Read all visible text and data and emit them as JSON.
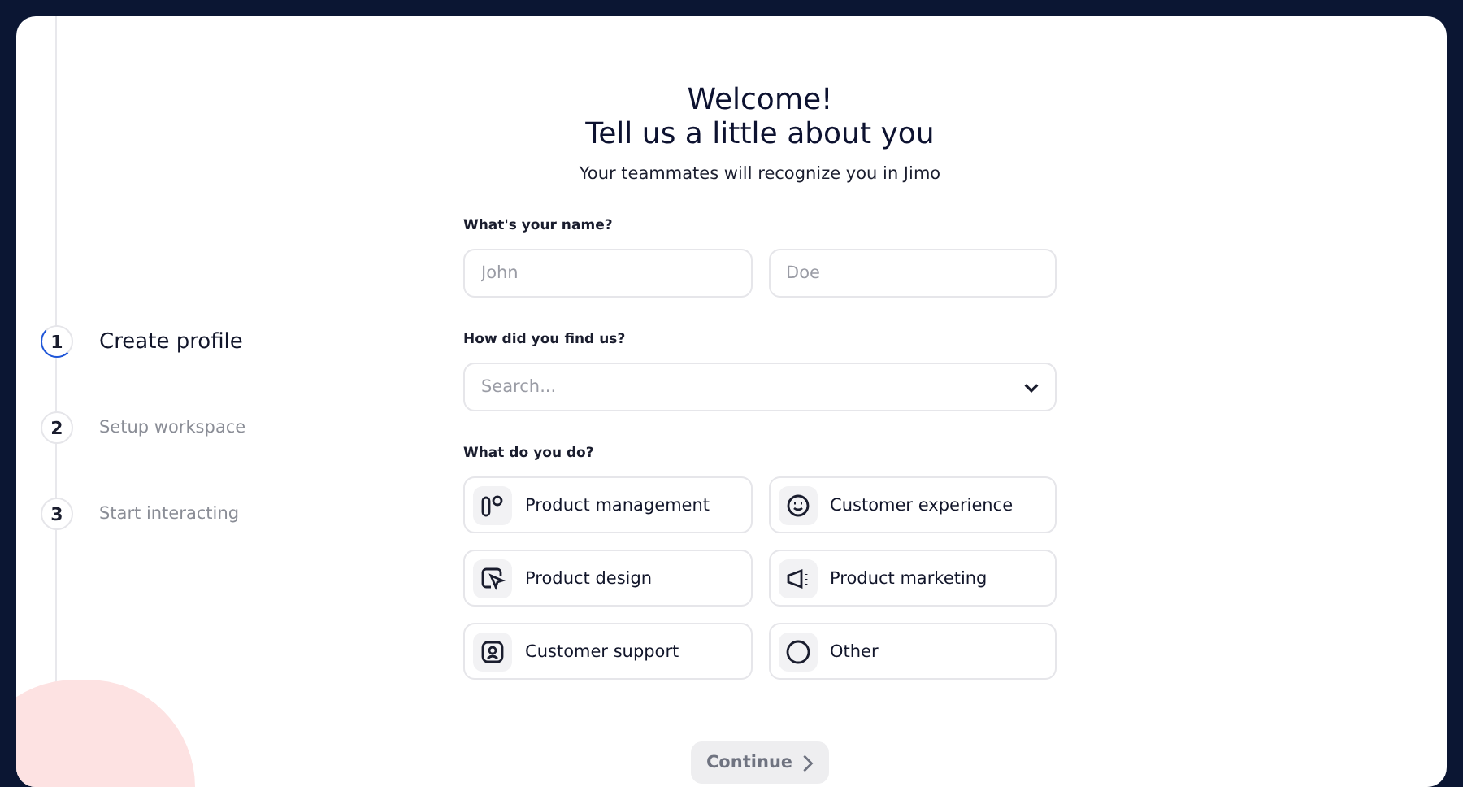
{
  "steps": [
    {
      "number": "1",
      "label": "Create profile",
      "selected": true
    },
    {
      "number": "2",
      "label": "Setup workspace",
      "selected": false
    },
    {
      "number": "3",
      "label": "Start interacting",
      "selected": false
    }
  ],
  "heading": {
    "line_1": "Welcome!",
    "line_2": "Tell us a little about you"
  },
  "subtitle": "Your teammates will recognize you in Jimo",
  "name_question": {
    "label": "What's your name?",
    "first_name": {
      "placeholder": "John"
    },
    "last_name": {
      "placeholder": "Doe"
    }
  },
  "source_question": {
    "label": "How did you find us?",
    "placeholder": "Search..."
  },
  "role_question": {
    "label": "What do you do?",
    "options": [
      {
        "kind": "management",
        "label": "Product management",
        "selected": false
      },
      {
        "kind": "experience",
        "label": "Customer experience",
        "selected": false
      },
      {
        "kind": "design",
        "label": "Product design",
        "selected": false
      },
      {
        "kind": "marketing",
        "label": "Product marketing",
        "selected": false
      },
      {
        "kind": "support",
        "label": "Customer support",
        "selected": false
      },
      {
        "kind": "other",
        "label": "Other",
        "selected": false
      }
    ]
  },
  "continue_button": {
    "label": "Continue",
    "disabled": true
  }
}
